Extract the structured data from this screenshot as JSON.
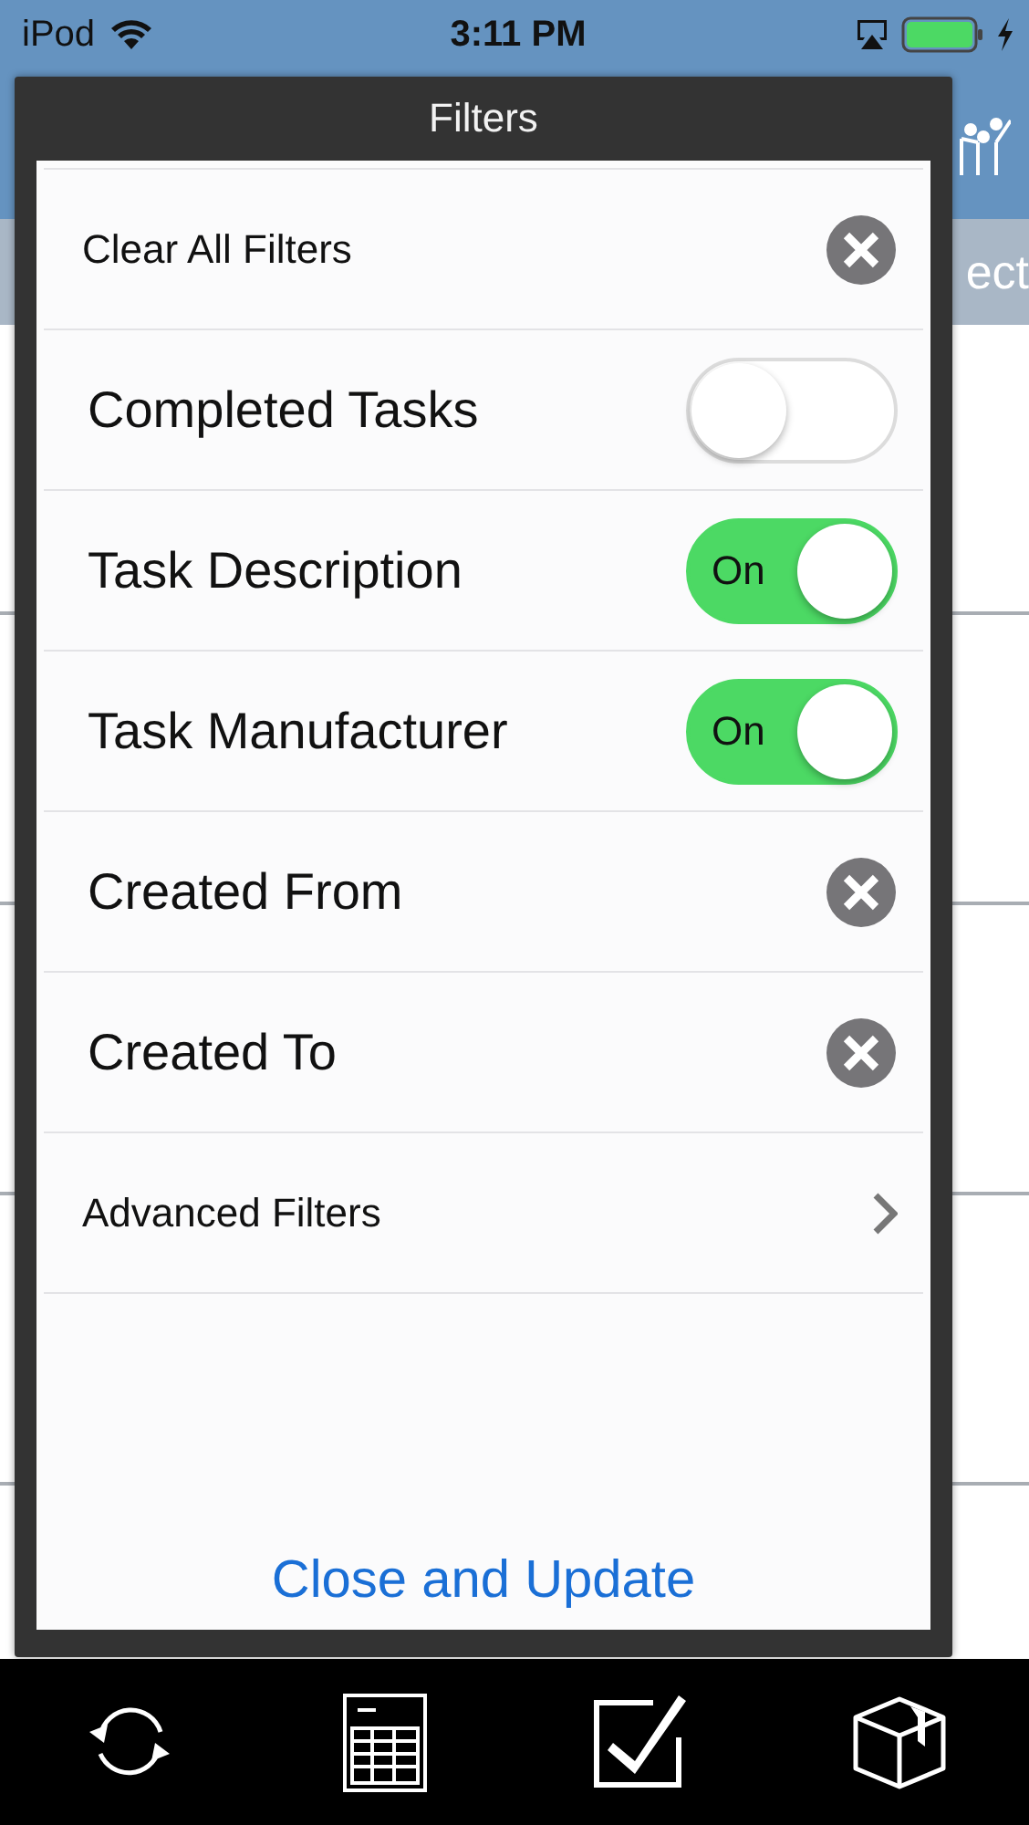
{
  "status_bar": {
    "carrier": "iPod",
    "time": "3:11 PM"
  },
  "background": {
    "subheader_text": "ect"
  },
  "dialog": {
    "title": "Filters",
    "rows": [
      {
        "kind": "clear",
        "label": "Clear All Filters"
      },
      {
        "kind": "toggle",
        "label": "Completed Tasks",
        "on": false
      },
      {
        "kind": "toggle",
        "label": "Task Description",
        "on": true,
        "on_text": "On"
      },
      {
        "kind": "toggle",
        "label": "Task Manufacturer",
        "on": true,
        "on_text": "On"
      },
      {
        "kind": "clear",
        "label": "Created From"
      },
      {
        "kind": "clear",
        "label": "Created To"
      },
      {
        "kind": "link",
        "label": "Advanced Filters"
      }
    ],
    "action": "Close and Update"
  }
}
